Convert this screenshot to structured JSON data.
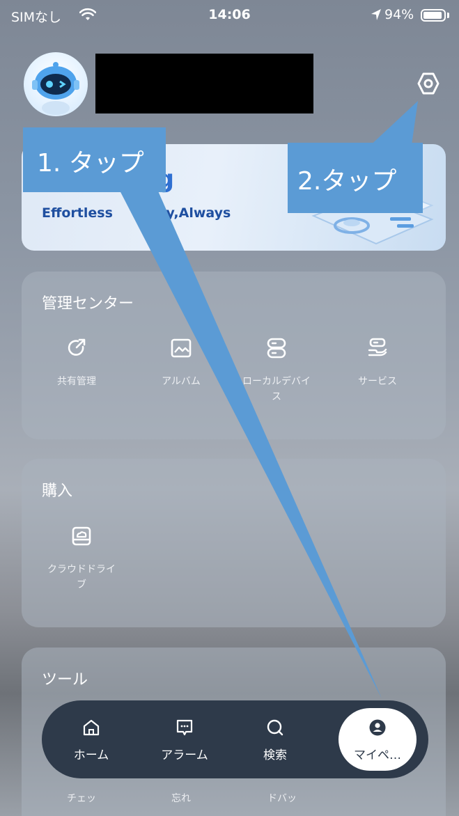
{
  "status_bar": {
    "carrier": "SIMなし",
    "time": "14:06",
    "battery_pct": "94%",
    "battery_level": 0.94
  },
  "banner": {
    "title": "ud Storag",
    "subtitle_left": "Effortless",
    "subtitle_right": "urity,Always"
  },
  "management": {
    "title": "管理センター",
    "items": [
      {
        "label": "共有管理",
        "icon": "share-refresh-icon"
      },
      {
        "label": "アルバム",
        "icon": "image-icon"
      },
      {
        "label": "ローカルデバイ\nス",
        "icon": "server-icon"
      },
      {
        "label": "サービス",
        "icon": "service-hand-icon"
      }
    ]
  },
  "purchase": {
    "title": "購入",
    "items": [
      {
        "label": "クラウドドライ\nブ",
        "icon": "cloud-drive-icon"
      }
    ]
  },
  "tools": {
    "title": "ツール",
    "partial_labels": [
      "チェッ",
      "忘れ",
      "ドバッ"
    ]
  },
  "tab_bar": {
    "tabs": [
      {
        "label": "ホーム",
        "icon": "home-icon"
      },
      {
        "label": "アラーム",
        "icon": "message-icon"
      },
      {
        "label": "検索",
        "icon": "search-icon"
      },
      {
        "label": "マイペ…",
        "icon": "user-circle-icon",
        "active": true
      }
    ]
  },
  "callouts": {
    "step1": "1. タップ",
    "step2": "2.タップ"
  },
  "colors": {
    "callout": "#5b9bd5",
    "tab_bar": "#2e3a4a",
    "banner_title": "#2f6fd1"
  }
}
